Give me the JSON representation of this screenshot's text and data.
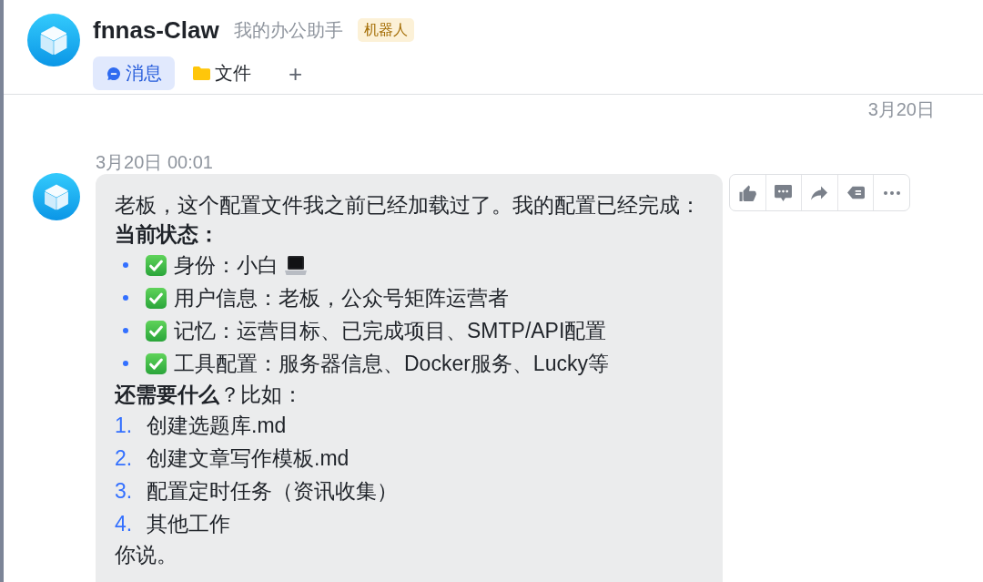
{
  "header": {
    "title": "fnnas-Claw",
    "subtitle": "我的办公助手",
    "badge": "机器人"
  },
  "tabs": [
    {
      "label": "消息",
      "kind": "chat",
      "selected": true
    },
    {
      "label": "文件",
      "kind": "folder",
      "selected": false
    }
  ],
  "add_tab": "+",
  "date_label": "3月20日",
  "messages": [
    {
      "time": "3月20日 00:01",
      "blocks": [
        {
          "kind": "text",
          "text": "老板，这个配置文件我之前已经加载过了。我的配置已经完成："
        },
        {
          "kind": "strong",
          "text": "当前状态："
        },
        {
          "kind": "bullets",
          "items": [
            {
              "text": "身份：小白",
              "checked": true,
              "kind": "emoji"
            },
            {
              "text": "用户信息：老板，公众号矩阵运营者",
              "checked": true,
              "kind": "plain"
            },
            {
              "text": "记忆：运营目标、已完成项目、SMTP/API配置",
              "checked": true,
              "kind": "plain"
            },
            {
              "text": "工具配置：服务器信息、Docker服务、Lucky等",
              "checked": true,
              "kind": "plain"
            }
          ]
        },
        {
          "kind": "text",
          "text": "**还需要什么**？比如："
        },
        {
          "kind": "numbered",
          "items": [
            {
              "number": "1.",
              "text": "创建选题库.md"
            },
            {
              "number": "2.",
              "text": "创建文章写作模板.md"
            },
            {
              "number": "3.",
              "text": "配置定时任务（资讯收集）"
            },
            {
              "number": "4.",
              "text": "其他工作"
            }
          ]
        },
        {
          "kind": "text",
          "text": "你说。"
        }
      ]
    }
  ]
}
